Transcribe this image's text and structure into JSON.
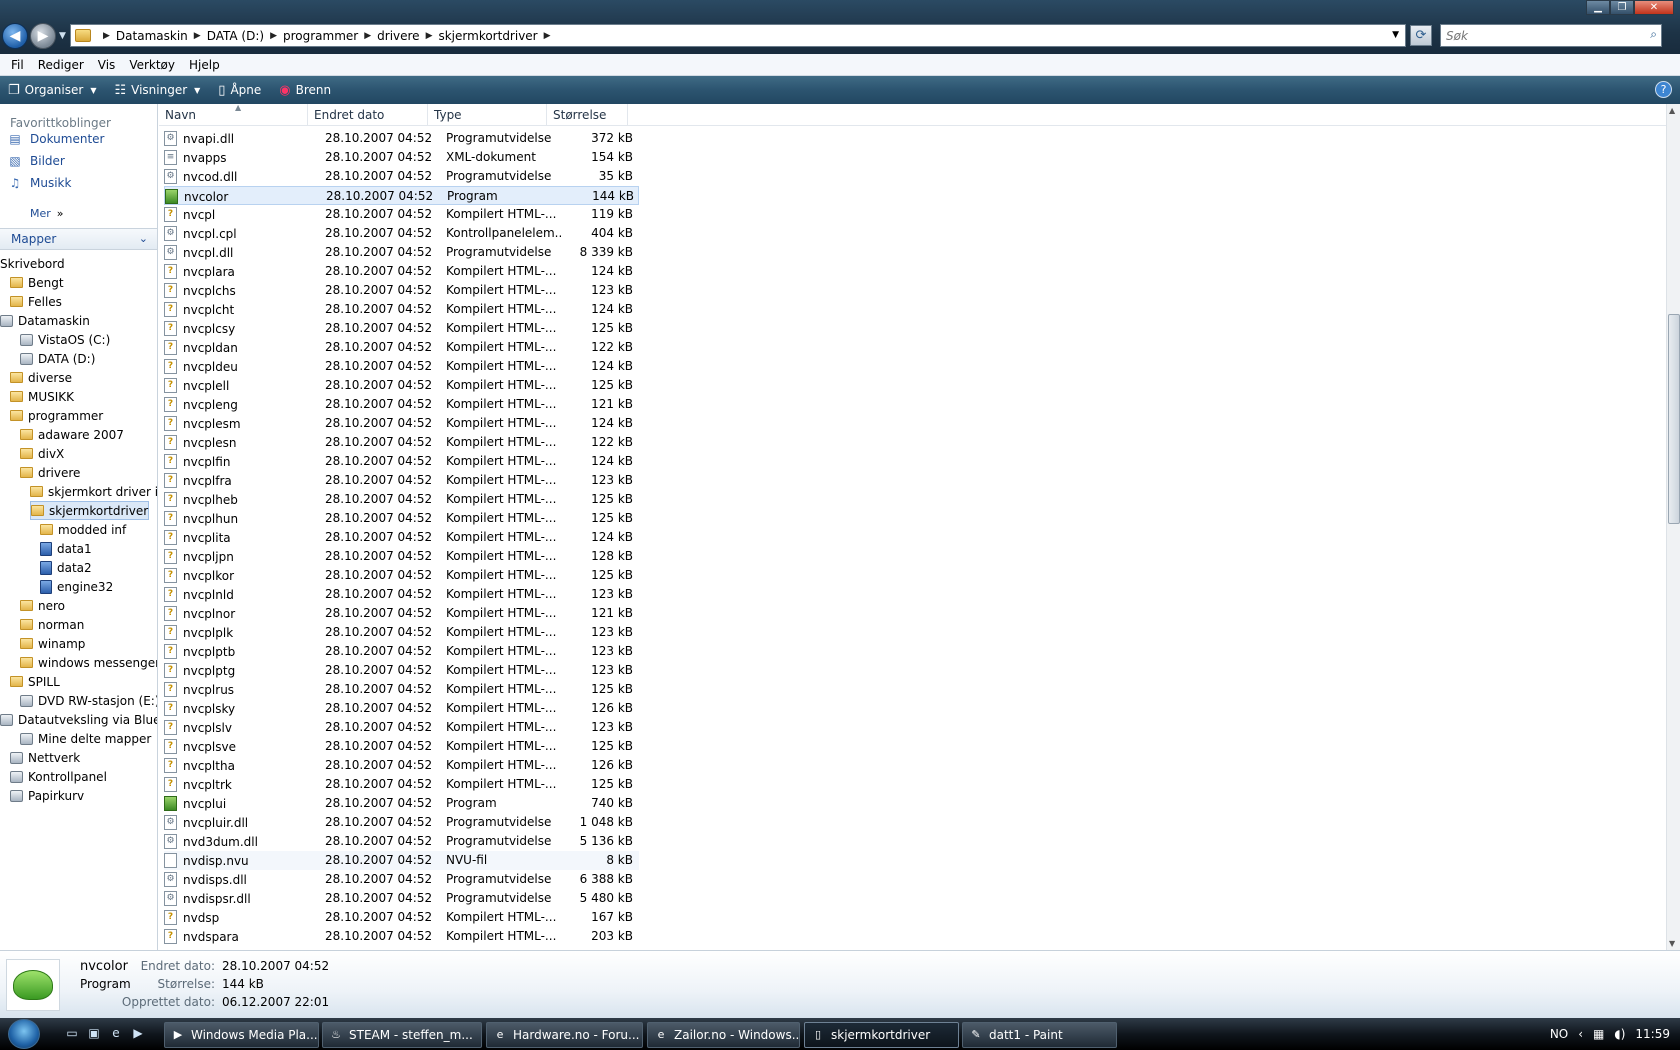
{
  "titlebar": {
    "breadcrumbs": [
      "Datamaskin",
      "DATA (D:)",
      "programmer",
      "drivere",
      "skjermkortdriver"
    ],
    "search_placeholder": "Søk"
  },
  "menu": [
    "Fil",
    "Rediger",
    "Vis",
    "Verktøy",
    "Hjelp"
  ],
  "commands": {
    "organise": "Organiser",
    "views": "Visninger",
    "open": "Åpne",
    "burn": "Brenn"
  },
  "nav": {
    "favorites_title": "Favorittkoblinger",
    "favorites": [
      "Dokumenter",
      "Bilder",
      "Musikk"
    ],
    "more": "Mer",
    "folders_header": "Mapper",
    "tree": [
      {
        "label": "Skrivebord",
        "type": "none"
      },
      {
        "label": "Bengt",
        "type": "folder"
      },
      {
        "label": "Felles",
        "type": "folder"
      },
      {
        "label": "Datamaskin",
        "type": "drive"
      },
      {
        "label": "VistaOS (C:)",
        "type": "drive"
      },
      {
        "label": "DATA (D:)",
        "type": "drive"
      },
      {
        "label": "diverse",
        "type": "folder"
      },
      {
        "label": "MUSIKK",
        "type": "folder"
      },
      {
        "label": "programmer",
        "type": "folder"
      },
      {
        "label": "adaware 2007",
        "type": "folder"
      },
      {
        "label": "divX",
        "type": "folder"
      },
      {
        "label": "drivere",
        "type": "folder"
      },
      {
        "label": "skjermkort driver ini",
        "type": "folder"
      },
      {
        "label": "skjermkortdriver",
        "type": "folder"
      },
      {
        "label": "modded inf",
        "type": "folder"
      },
      {
        "label": "data1",
        "type": "box"
      },
      {
        "label": "data2",
        "type": "box"
      },
      {
        "label": "engine32",
        "type": "box"
      },
      {
        "label": "nero",
        "type": "folder"
      },
      {
        "label": "norman",
        "type": "folder"
      },
      {
        "label": "winamp",
        "type": "folder"
      },
      {
        "label": "windows messenger",
        "type": "folder"
      },
      {
        "label": "SPILL",
        "type": "folder"
      },
      {
        "label": "DVD RW-stasjon (E:)",
        "type": "drive"
      },
      {
        "label": "Datautveksling via Blueto",
        "type": "drive"
      },
      {
        "label": "Mine delte mapper",
        "type": "drive"
      },
      {
        "label": "Nettverk",
        "type": "drive"
      },
      {
        "label": "Kontrollpanel",
        "type": "drive"
      },
      {
        "label": "Papirkurv",
        "type": "drive"
      }
    ]
  },
  "columns": {
    "name": "Navn",
    "date": "Endret dato",
    "type": "Type",
    "size": "Størrelse"
  },
  "files": [
    {
      "name": "nvapi.dll",
      "date": "28.10.2007 04:52",
      "type": "Programutvidelse",
      "size": "372 kB",
      "icon": "dll"
    },
    {
      "name": "nvapps",
      "date": "28.10.2007 04:52",
      "type": "XML-dokument",
      "size": "154 kB",
      "icon": "xml"
    },
    {
      "name": "nvcod.dll",
      "date": "28.10.2007 04:52",
      "type": "Programutvidelse",
      "size": "35 kB",
      "icon": "dll"
    },
    {
      "name": "nvcolor",
      "date": "28.10.2007 04:52",
      "type": "Program",
      "size": "144 kB",
      "icon": "exe"
    },
    {
      "name": "nvcpl",
      "date": "28.10.2007 04:52",
      "type": "Kompilert HTML-...",
      "size": "119 kB",
      "icon": "help"
    },
    {
      "name": "nvcpl.cpl",
      "date": "28.10.2007 04:52",
      "type": "Kontrollpanelelem...",
      "size": "404 kB",
      "icon": "cpl"
    },
    {
      "name": "nvcpl.dll",
      "date": "28.10.2007 04:52",
      "type": "Programutvidelse",
      "size": "8 339 kB",
      "icon": "dll"
    },
    {
      "name": "nvcplara",
      "date": "28.10.2007 04:52",
      "type": "Kompilert HTML-...",
      "size": "124 kB",
      "icon": "help"
    },
    {
      "name": "nvcplchs",
      "date": "28.10.2007 04:52",
      "type": "Kompilert HTML-...",
      "size": "123 kB",
      "icon": "help"
    },
    {
      "name": "nvcplcht",
      "date": "28.10.2007 04:52",
      "type": "Kompilert HTML-...",
      "size": "124 kB",
      "icon": "help"
    },
    {
      "name": "nvcplcsy",
      "date": "28.10.2007 04:52",
      "type": "Kompilert HTML-...",
      "size": "125 kB",
      "icon": "help"
    },
    {
      "name": "nvcpldan",
      "date": "28.10.2007 04:52",
      "type": "Kompilert HTML-...",
      "size": "122 kB",
      "icon": "help"
    },
    {
      "name": "nvcpldeu",
      "date": "28.10.2007 04:52",
      "type": "Kompilert HTML-...",
      "size": "124 kB",
      "icon": "help"
    },
    {
      "name": "nvcplell",
      "date": "28.10.2007 04:52",
      "type": "Kompilert HTML-...",
      "size": "125 kB",
      "icon": "help"
    },
    {
      "name": "nvcpleng",
      "date": "28.10.2007 04:52",
      "type": "Kompilert HTML-...",
      "size": "121 kB",
      "icon": "help"
    },
    {
      "name": "nvcplesm",
      "date": "28.10.2007 04:52",
      "type": "Kompilert HTML-...",
      "size": "124 kB",
      "icon": "help"
    },
    {
      "name": "nvcplesn",
      "date": "28.10.2007 04:52",
      "type": "Kompilert HTML-...",
      "size": "122 kB",
      "icon": "help"
    },
    {
      "name": "nvcplfin",
      "date": "28.10.2007 04:52",
      "type": "Kompilert HTML-...",
      "size": "124 kB",
      "icon": "help"
    },
    {
      "name": "nvcplfra",
      "date": "28.10.2007 04:52",
      "type": "Kompilert HTML-...",
      "size": "123 kB",
      "icon": "help"
    },
    {
      "name": "nvcplheb",
      "date": "28.10.2007 04:52",
      "type": "Kompilert HTML-...",
      "size": "125 kB",
      "icon": "help"
    },
    {
      "name": "nvcplhun",
      "date": "28.10.2007 04:52",
      "type": "Kompilert HTML-...",
      "size": "125 kB",
      "icon": "help"
    },
    {
      "name": "nvcplita",
      "date": "28.10.2007 04:52",
      "type": "Kompilert HTML-...",
      "size": "124 kB",
      "icon": "help"
    },
    {
      "name": "nvcpljpn",
      "date": "28.10.2007 04:52",
      "type": "Kompilert HTML-...",
      "size": "128 kB",
      "icon": "help"
    },
    {
      "name": "nvcplkor",
      "date": "28.10.2007 04:52",
      "type": "Kompilert HTML-...",
      "size": "125 kB",
      "icon": "help"
    },
    {
      "name": "nvcplnld",
      "date": "28.10.2007 04:52",
      "type": "Kompilert HTML-...",
      "size": "123 kB",
      "icon": "help"
    },
    {
      "name": "nvcplnor",
      "date": "28.10.2007 04:52",
      "type": "Kompilert HTML-...",
      "size": "121 kB",
      "icon": "help"
    },
    {
      "name": "nvcplplk",
      "date": "28.10.2007 04:52",
      "type": "Kompilert HTML-...",
      "size": "123 kB",
      "icon": "help"
    },
    {
      "name": "nvcplptb",
      "date": "28.10.2007 04:52",
      "type": "Kompilert HTML-...",
      "size": "123 kB",
      "icon": "help"
    },
    {
      "name": "nvcplptg",
      "date": "28.10.2007 04:52",
      "type": "Kompilert HTML-...",
      "size": "123 kB",
      "icon": "help"
    },
    {
      "name": "nvcplrus",
      "date": "28.10.2007 04:52",
      "type": "Kompilert HTML-...",
      "size": "125 kB",
      "icon": "help"
    },
    {
      "name": "nvcplsky",
      "date": "28.10.2007 04:52",
      "type": "Kompilert HTML-...",
      "size": "126 kB",
      "icon": "help"
    },
    {
      "name": "nvcplslv",
      "date": "28.10.2007 04:52",
      "type": "Kompilert HTML-...",
      "size": "123 kB",
      "icon": "help"
    },
    {
      "name": "nvcplsve",
      "date": "28.10.2007 04:52",
      "type": "Kompilert HTML-...",
      "size": "125 kB",
      "icon": "help"
    },
    {
      "name": "nvcpltha",
      "date": "28.10.2007 04:52",
      "type": "Kompilert HTML-...",
      "size": "126 kB",
      "icon": "help"
    },
    {
      "name": "nvcpltrk",
      "date": "28.10.2007 04:52",
      "type": "Kompilert HTML-...",
      "size": "125 kB",
      "icon": "help"
    },
    {
      "name": "nvcplui",
      "date": "28.10.2007 04:52",
      "type": "Program",
      "size": "740 kB",
      "icon": "exe"
    },
    {
      "name": "nvcpluir.dll",
      "date": "28.10.2007 04:52",
      "type": "Programutvidelse",
      "size": "1 048 kB",
      "icon": "dll"
    },
    {
      "name": "nvd3dum.dll",
      "date": "28.10.2007 04:52",
      "type": "Programutvidelse",
      "size": "5 136 kB",
      "icon": "dll"
    },
    {
      "name": "nvdisp.nvu",
      "date": "28.10.2007 04:52",
      "type": "NVU-fil",
      "size": "8 kB",
      "icon": "nvu"
    },
    {
      "name": "nvdisps.dll",
      "date": "28.10.2007 04:52",
      "type": "Programutvidelse",
      "size": "6 388 kB",
      "icon": "dll"
    },
    {
      "name": "nvdispsr.dll",
      "date": "28.10.2007 04:52",
      "type": "Programutvidelse",
      "size": "5 480 kB",
      "icon": "dll"
    },
    {
      "name": "nvdsp",
      "date": "28.10.2007 04:52",
      "type": "Kompilert HTML-...",
      "size": "167 kB",
      "icon": "help"
    },
    {
      "name": "nvdspara",
      "date": "28.10.2007 04:52",
      "type": "Kompilert HTML-...",
      "size": "203 kB",
      "icon": "help"
    }
  ],
  "details": {
    "name": "nvcolor",
    "type": "Program",
    "modified_label": "Endret dato:",
    "modified": "28.10.2007 04:52",
    "size_label": "Størrelse:",
    "size": "144 kB",
    "created_label": "Opprettet dato:",
    "created": "06.12.2007 22:01"
  },
  "taskbar": {
    "tasks": [
      "Windows Media Pla...",
      "STEAM - steffen_m...",
      "Hardware.no - Foru...",
      "Zailor.no - Windows...",
      "skjermkortdriver",
      "datt1 - Paint"
    ],
    "lang": "NO",
    "clock": "11:59"
  }
}
